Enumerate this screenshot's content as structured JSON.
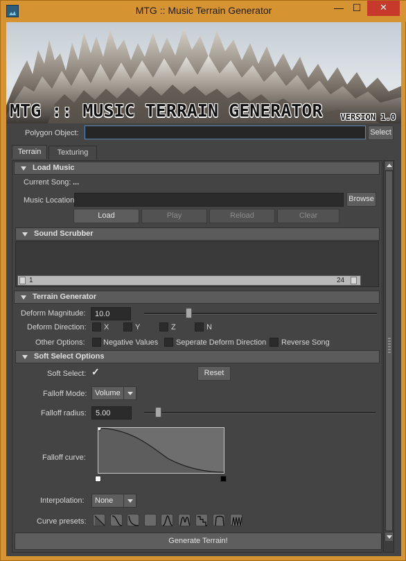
{
  "window": {
    "title": "MTG :: Music Terrain Generator",
    "min_label": "—",
    "max_label": "☐",
    "close_label": "✕"
  },
  "banner": {
    "title": "MTG :: MUSIC TERRAIN GENERATOR",
    "version": "VERSION 1.0"
  },
  "polygon": {
    "label": "Polygon Object:",
    "value": "",
    "select_label": "Select"
  },
  "tabs": [
    {
      "label": "Terrain",
      "active": true
    },
    {
      "label": "Texturing",
      "active": false
    }
  ],
  "load_music": {
    "header": "Load Music",
    "current_song_label": "Current Song:",
    "current_song_value": "...",
    "location_label": "Music Location",
    "location_value": "",
    "browse_label": "Browse",
    "buttons": {
      "load": "Load",
      "play": "Play",
      "reload": "Reload",
      "clear": "Clear"
    }
  },
  "sound_scrubber": {
    "header": "Sound Scrubber",
    "start": "1",
    "end": "24"
  },
  "terrain_generator": {
    "header": "Terrain Generator",
    "deform_magnitude_label": "Deform Magnitude:",
    "deform_magnitude_value": "10.0",
    "deform_magnitude_fraction": 0.19,
    "deform_direction_label": "Deform Direction:",
    "directions": [
      "X",
      "Y",
      "Z",
      "N"
    ],
    "other_options_label": "Other Options:",
    "options": [
      "Negative Values",
      "Seperate Deform Direction",
      "Reverse Song"
    ]
  },
  "soft_select": {
    "header": "Soft Select Options",
    "soft_select_label": "Soft Select:",
    "soft_select_checked": true,
    "reset_label": "Reset",
    "falloff_mode_label": "Falloff Mode:",
    "falloff_mode_value": "Volume",
    "falloff_radius_label": "Falloff radius:",
    "falloff_radius_value": "5.00",
    "falloff_radius_fraction": 0.06,
    "falloff_curve_label": "Falloff curve:",
    "interpolation_label": "Interpolation:",
    "interpolation_value": "None",
    "curve_presets_label": "Curve presets:"
  },
  "generate_label": "Generate Terrain!",
  "colors": {
    "accent": "#d59431",
    "panel": "#444444",
    "close": "#c7392b"
  }
}
